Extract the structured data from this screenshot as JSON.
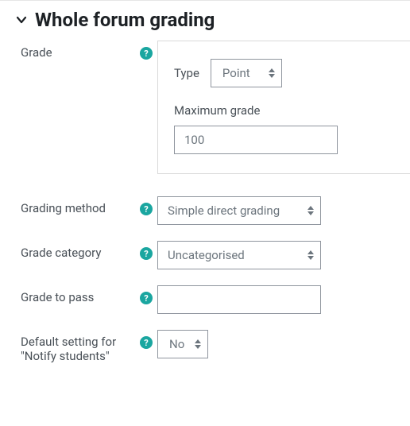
{
  "section": {
    "title": "Whole forum grading"
  },
  "grade": {
    "label": "Grade",
    "type_label": "Type",
    "type_value": "Point",
    "max_label": "Maximum grade",
    "max_value": "100"
  },
  "method": {
    "label": "Grading method",
    "value": "Simple direct grading"
  },
  "category": {
    "label": "Grade category",
    "value": "Uncategorised"
  },
  "pass": {
    "label": "Grade to pass",
    "value": ""
  },
  "notify": {
    "label": "Default setting for \"Notify students\"",
    "value": "No"
  }
}
